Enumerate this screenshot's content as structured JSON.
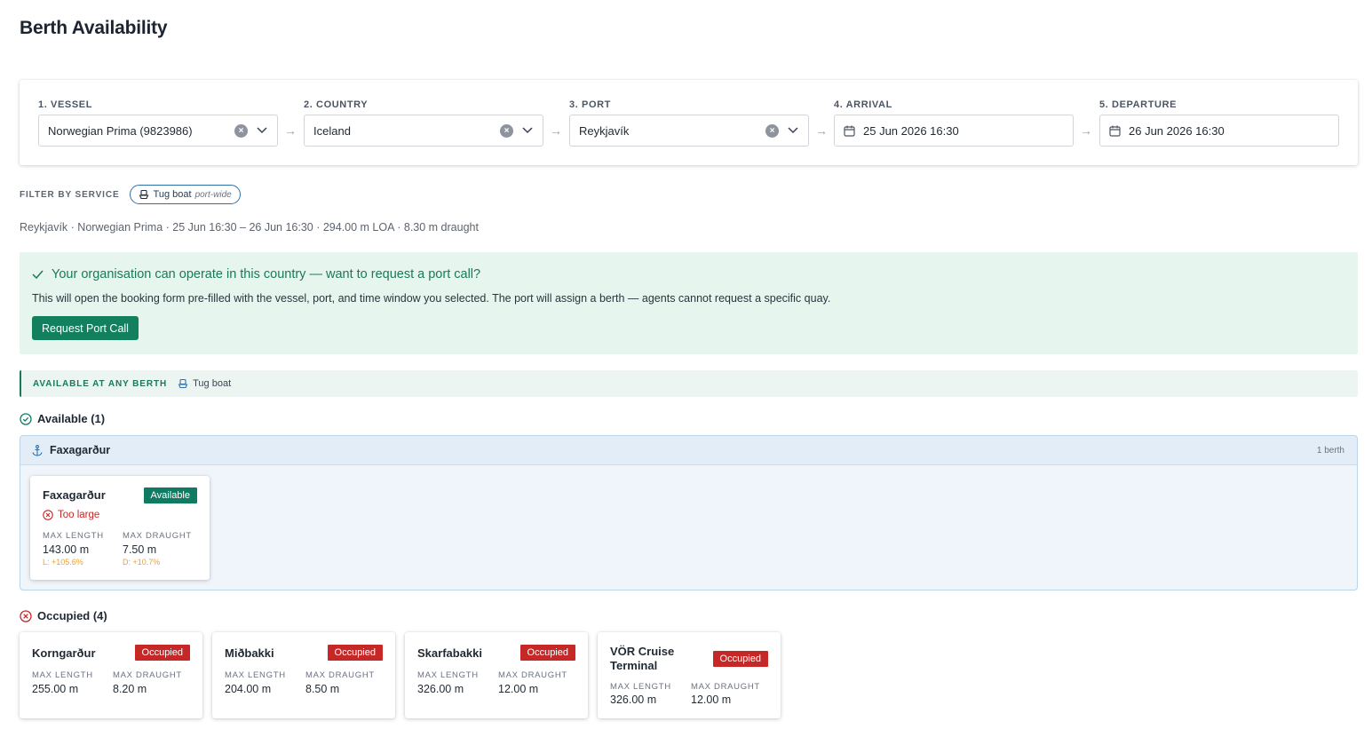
{
  "page": {
    "title": "Berth Availability"
  },
  "selector": {
    "vessel": {
      "label": "1. VESSEL",
      "value": "Norwegian Prima (9823986)"
    },
    "country": {
      "label": "2. COUNTRY",
      "value": "Iceland"
    },
    "port": {
      "label": "3. PORT",
      "value": "Reykjavík"
    },
    "arrival": {
      "label": "4. ARRIVAL",
      "value": "25 Jun 2026 16:30"
    },
    "departure": {
      "label": "5. DEPARTURE",
      "value": "26 Jun 2026 16:30"
    },
    "arrow": "→"
  },
  "filter": {
    "label": "FILTER BY SERVICE",
    "chip": {
      "name": "Tug boat",
      "scope": "port-wide"
    }
  },
  "summary": "Reykjavík · Norwegian Prima · 25 Jun 16:30 – 26 Jun 16:30 · 294.00 m LOA · 8.30 m draught",
  "banner": {
    "title": "Your organisation can operate in this country — want to request a port call?",
    "description": "This will open the booking form pre-filled with the vessel, port, and time window you selected. The port will assign a berth — agents cannot request a specific quay.",
    "button": "Request Port Call",
    "accent": "#12805c"
  },
  "any_berth": {
    "label": "AVAILABLE AT ANY BERTH",
    "service": "Tug boat"
  },
  "available": {
    "heading": "Available (1)",
    "group": {
      "name": "Faxagarður",
      "count": "1 berth",
      "berths": [
        {
          "name": "Faxagarður",
          "status": "Available",
          "warning": "Too large",
          "length_label": "MAX LENGTH",
          "length": "143.00 m",
          "length_delta": "L: +105.6%",
          "draught_label": "MAX DRAUGHT",
          "draught": "7.50 m",
          "draught_delta": "D: +10.7%"
        }
      ]
    }
  },
  "occupied": {
    "heading": "Occupied (4)",
    "berths": [
      {
        "name": "Korngarður",
        "status": "Occupied",
        "length_label": "MAX LENGTH",
        "length": "255.00 m",
        "draught_label": "MAX DRAUGHT",
        "draught": "8.20 m"
      },
      {
        "name": "Miðbakki",
        "status": "Occupied",
        "length_label": "MAX LENGTH",
        "length": "204.00 m",
        "draught_label": "MAX DRAUGHT",
        "draught": "8.50 m"
      },
      {
        "name": "Skarfabakki",
        "status": "Occupied",
        "length_label": "MAX LENGTH",
        "length": "326.00 m",
        "draught_label": "MAX DRAUGHT",
        "draught": "12.00 m"
      },
      {
        "name": "VÖR Cruise Terminal",
        "status": "Occupied",
        "length_label": "MAX LENGTH",
        "length": "326.00 m",
        "draught_label": "MAX DRAUGHT",
        "draught": "12.00 m"
      }
    ]
  },
  "colors": {
    "available": "#0f7b63",
    "occupied": "#c62828",
    "warning_delta": "#e6a23c",
    "banner_bg": "#e6f6ef"
  }
}
